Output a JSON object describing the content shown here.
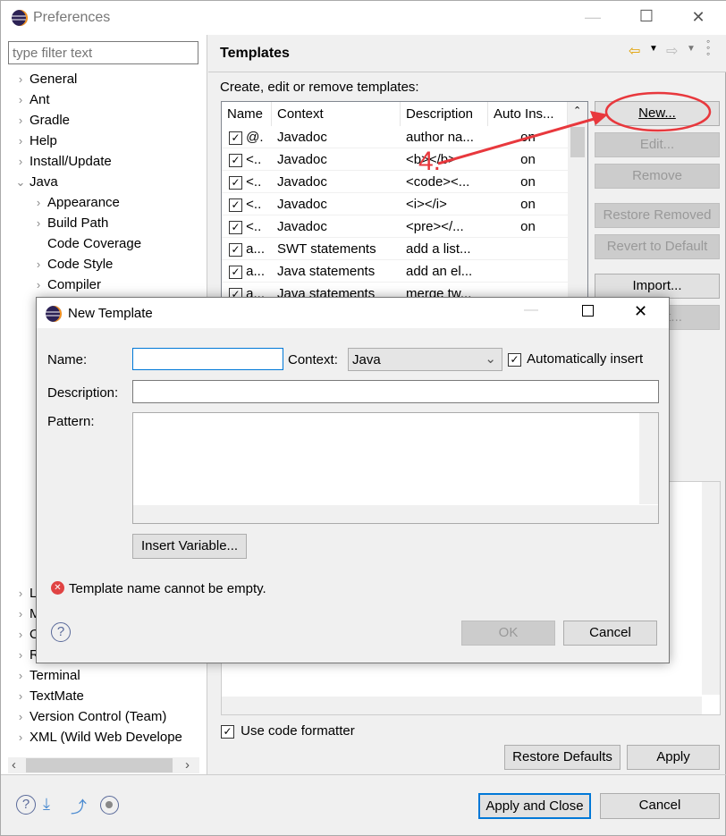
{
  "window": {
    "title": "Preferences",
    "min": "—",
    "max": "☐",
    "close": "✕"
  },
  "filter": {
    "placeholder": "type filter text"
  },
  "tree": {
    "top": [
      "General",
      "Ant",
      "Gradle",
      "Help",
      "Install/Update"
    ],
    "java": "Java",
    "java_children": [
      {
        "label": "Appearance",
        "chevron": true
      },
      {
        "label": "Build Path",
        "chevron": true
      },
      {
        "label": "Code Coverage",
        "chevron": false
      },
      {
        "label": "Code Style",
        "chevron": true
      },
      {
        "label": "Compiler",
        "chevron": true
      }
    ],
    "bottom": [
      "L",
      "M",
      "O",
      "R",
      "Terminal",
      "TextMate",
      "Version Control (Team)",
      "XML (Wild Web Develope"
    ]
  },
  "page": {
    "title": "Templates",
    "description": "Create, edit or remove templates:"
  },
  "table": {
    "columns": [
      "Name",
      "Context",
      "Description",
      "Auto Ins..."
    ],
    "rows": [
      {
        "name": "@.",
        "context": "Javadoc",
        "description": "author na...",
        "auto": "on",
        "checked": true
      },
      {
        "name": "<..",
        "context": "Javadoc",
        "description": "<b></b>",
        "auto": "on",
        "checked": true
      },
      {
        "name": "<..",
        "context": "Javadoc",
        "description": "<code><...",
        "auto": "on",
        "checked": true
      },
      {
        "name": "<..",
        "context": "Javadoc",
        "description": "<i></i>",
        "auto": "on",
        "checked": true
      },
      {
        "name": "<..",
        "context": "Javadoc",
        "description": "<pre></...",
        "auto": "on",
        "checked": true
      },
      {
        "name": "a...",
        "context": "SWT statements",
        "description": "add a list...",
        "auto": "",
        "checked": true
      },
      {
        "name": "a...",
        "context": "Java statements",
        "description": "add an el...",
        "auto": "",
        "checked": true
      },
      {
        "name": "a...",
        "context": "Java statements",
        "description": "merge tw...",
        "auto": "",
        "checked": true
      }
    ]
  },
  "buttons": {
    "new": "New...",
    "edit": "Edit...",
    "remove": "Remove",
    "restore_removed": "Restore Removed",
    "revert": "Revert to Default",
    "import": "Import...",
    "export": "Export..."
  },
  "formatter": {
    "label": "Use code formatter",
    "checked": true
  },
  "footer": {
    "restore_defaults": "Restore Defaults",
    "apply": "Apply",
    "apply_close": "Apply and Close",
    "cancel": "Cancel"
  },
  "annotation": {
    "step": "4.",
    "color": "#e8383d"
  },
  "dialog": {
    "title": "New Template",
    "name_label": "Name:",
    "name_value": "",
    "context_label": "Context:",
    "context_value": "Java",
    "auto_insert_label": "Automatically insert",
    "auto_insert_checked": true,
    "description_label": "Description:",
    "description_value": "",
    "pattern_label": "Pattern:",
    "insert_variable": "Insert Variable...",
    "error": "Template name cannot be empty.",
    "ok": "OK",
    "cancel": "Cancel"
  }
}
